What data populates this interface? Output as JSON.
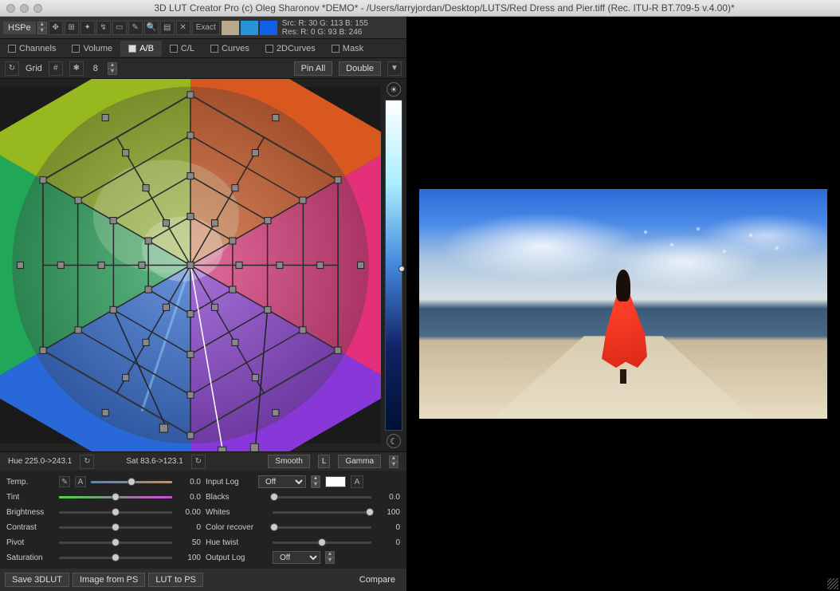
{
  "title": "3D LUT Creator Pro (c) Oleg Sharonov *DEMO* - /Users/larryjordan/Desktop/LUTS/Red Dress and Pier.tiff (Rec. ITU-R BT.709-5 v.4.00)*",
  "toolbar": {
    "mode": "HSPe",
    "exact": "Exact",
    "src": "Src: R:  30   G: 113   B: 155",
    "res": "Res: R:   0   G:  93   B: 246",
    "swatch1": "#b8a88c",
    "swatch2": "#2894d8",
    "swatch3": "#1060e8"
  },
  "tabs": [
    "Channels",
    "Volume",
    "A/B",
    "C/L",
    "Curves",
    "2DCurves",
    "Mask"
  ],
  "active_tab": 2,
  "gridbar": {
    "grid": "Grid",
    "size": "8",
    "pinall": "Pin All",
    "double": "Double"
  },
  "status": {
    "hue": "Hue 225.0->243.1",
    "sat": "Sat 83.6->123.1",
    "smooth": "Smooth",
    "l": "L",
    "gamma": "Gamma"
  },
  "sliders_left": [
    {
      "label": "Temp.",
      "value": "0.0",
      "pos": 50,
      "grad": "linear-gradient(90deg,#48d,#888,#d84)"
    },
    {
      "label": "Tint",
      "value": "0.0",
      "pos": 50,
      "grad": "linear-gradient(90deg,#4d4,#888,#d4d)"
    },
    {
      "label": "Brightness",
      "value": "0.00",
      "pos": 50
    },
    {
      "label": "Contrast",
      "value": "0",
      "pos": 50
    },
    {
      "label": "Pivot",
      "value": "50",
      "pos": 50
    },
    {
      "label": "Saturation",
      "value": "100",
      "pos": 50
    }
  ],
  "sliders_right": {
    "input_log": {
      "label": "Input Log",
      "value": "Off"
    },
    "a": "A",
    "rows": [
      {
        "label": "Blacks",
        "value": "0.0",
        "pos": 2
      },
      {
        "label": "Whites",
        "value": "100",
        "pos": 98
      },
      {
        "label": "Color recover",
        "value": "0",
        "pos": 2
      },
      {
        "label": "Hue twist",
        "value": "0",
        "pos": 50
      }
    ],
    "output_log": {
      "label": "Output Log",
      "value": "Off"
    }
  },
  "bottom": {
    "save": "Save 3DLUT",
    "from_ps": "Image from PS",
    "to_ps": "LUT to PS",
    "compare": "Compare"
  },
  "temp_icons": {
    "picker": "✎",
    "a": "A"
  }
}
